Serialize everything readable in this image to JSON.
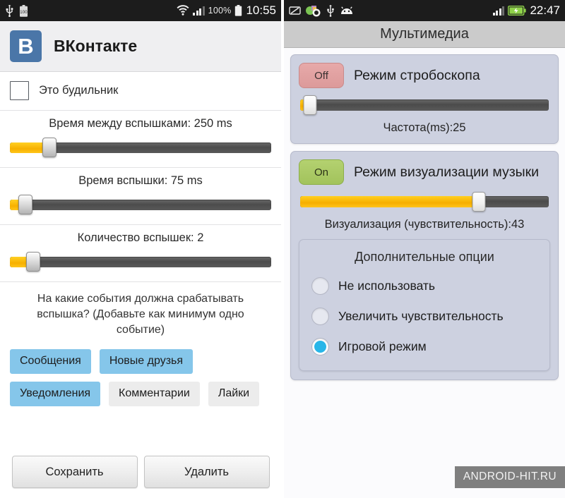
{
  "left_screen": {
    "statusbar": {
      "icons": [
        "usb-icon",
        "battery-full-100-icon"
      ],
      "right_icons": [
        "wifi-icon",
        "signal-bars-icon",
        "battery-icon"
      ],
      "battery_percent": "100%",
      "clock": "10:55"
    },
    "app": {
      "logo_letter": "B",
      "logo_color": "#4a76a8",
      "title": "ВКонтакте"
    },
    "alarm_checkbox": {
      "label": "Это будильник",
      "checked": false
    },
    "sliders": [
      {
        "label": "Время между вспышками: 250 ms",
        "value": 250,
        "unit": "ms",
        "percent": 15
      },
      {
        "label": "Время вспышки: 75 ms",
        "value": 75,
        "unit": "ms",
        "percent": 5
      },
      {
        "label": "Количество вспышек: 2",
        "value": 2,
        "unit": "",
        "percent": 8
      }
    ],
    "events_hint": "На какие события должна срабатывать вспышка? (Добавьте как минимум одно событие)",
    "event_chips": [
      [
        {
          "label": "Сообщения",
          "selected": true
        },
        {
          "label": "Новые друзья",
          "selected": true
        }
      ],
      [
        {
          "label": "Уведомления",
          "selected": true
        },
        {
          "label": "Комментарии",
          "selected": false
        },
        {
          "label": "Лайки",
          "selected": false
        }
      ]
    ],
    "buttons": {
      "save": "Сохранить",
      "delete": "Удалить"
    },
    "colors": {
      "chip_selected": "#85c6ea",
      "chip_unselected": "#ececec",
      "slider_fill": "#f7b000"
    }
  },
  "right_screen": {
    "statusbar": {
      "icons": [
        "mute-pencil-icon",
        "apps-cluster-icon",
        "usb-icon",
        "android-head-icon"
      ],
      "right_icons": [
        "signal-bars-icon",
        "battery-charging-icon"
      ],
      "clock": "22:47"
    },
    "header_title": "Мультимедиа",
    "cards": [
      {
        "toggle_label": "Off",
        "toggle_state": "off",
        "title": "Режим стробоскопа",
        "slider_percent": 3,
        "caption": "Частота(ms):25",
        "value": 25
      },
      {
        "toggle_label": "On",
        "toggle_state": "on",
        "title": "Режим визуализации музыки",
        "slider_percent": 71,
        "caption": "Визуализация (чувствительность):43",
        "value": 43
      }
    ],
    "options": {
      "title": "Дополнительные опции",
      "items": [
        {
          "label": "Не использовать",
          "selected": false
        },
        {
          "label": "Увеличить чувствительность",
          "selected": false
        },
        {
          "label": "Игровой режим",
          "selected": true
        }
      ]
    },
    "colors": {
      "toggle_off": "#dc9a9a",
      "toggle_on": "#a2c35c",
      "radio_selected": "#29b6e8",
      "card_bg": "#cdd1e0"
    }
  },
  "watermark": "ANDROID-HIT.RU"
}
